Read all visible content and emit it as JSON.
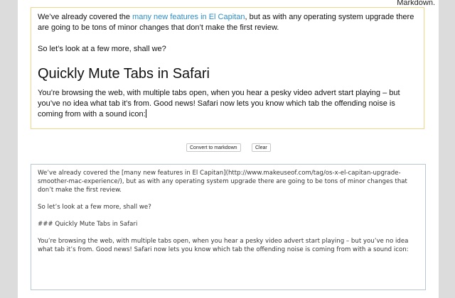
{
  "header": {
    "note": "Markdown."
  },
  "editor": {
    "p1_before": "We’ve already covered the ",
    "p1_link": "many new features in El Capitan",
    "p1_after": ", but as with any operating system upgrade there are going to be tons of minor changes that don’t make the first review.",
    "p2": "So let’s look at a few more, shall we?",
    "heading": "Quickly Mute Tabs in Safari",
    "p3": "You’re browsing the web, with multiple tabs open, when you hear a pesky video advert start playing – but you’ve no idea what tab it’s from. Good news! Safari now lets you know which tab the offending noise is coming from with a sound icon:"
  },
  "buttons": {
    "convert": "Convert to markdown",
    "clear": "Clear"
  },
  "output": {
    "value": "We’ve already covered the [many new features in El Capitan](http://www.makeuseof.com/tag/os-x-el-capitan-upgrade-smoother-mac-experience/), but as with any operating system upgrade there are going to be tons of minor changes that don’t make the first review.\n\nSo let’s look at a few more, shall we?\n\n### Quickly Mute Tabs in Safari\n\nYou’re browsing the web, with multiple tabs open, when you hear a pesky video advert start playing – but you’ve no idea what tab it’s from. Good news! Safari now lets you know which tab the offending noise is coming from with a sound icon:"
  }
}
